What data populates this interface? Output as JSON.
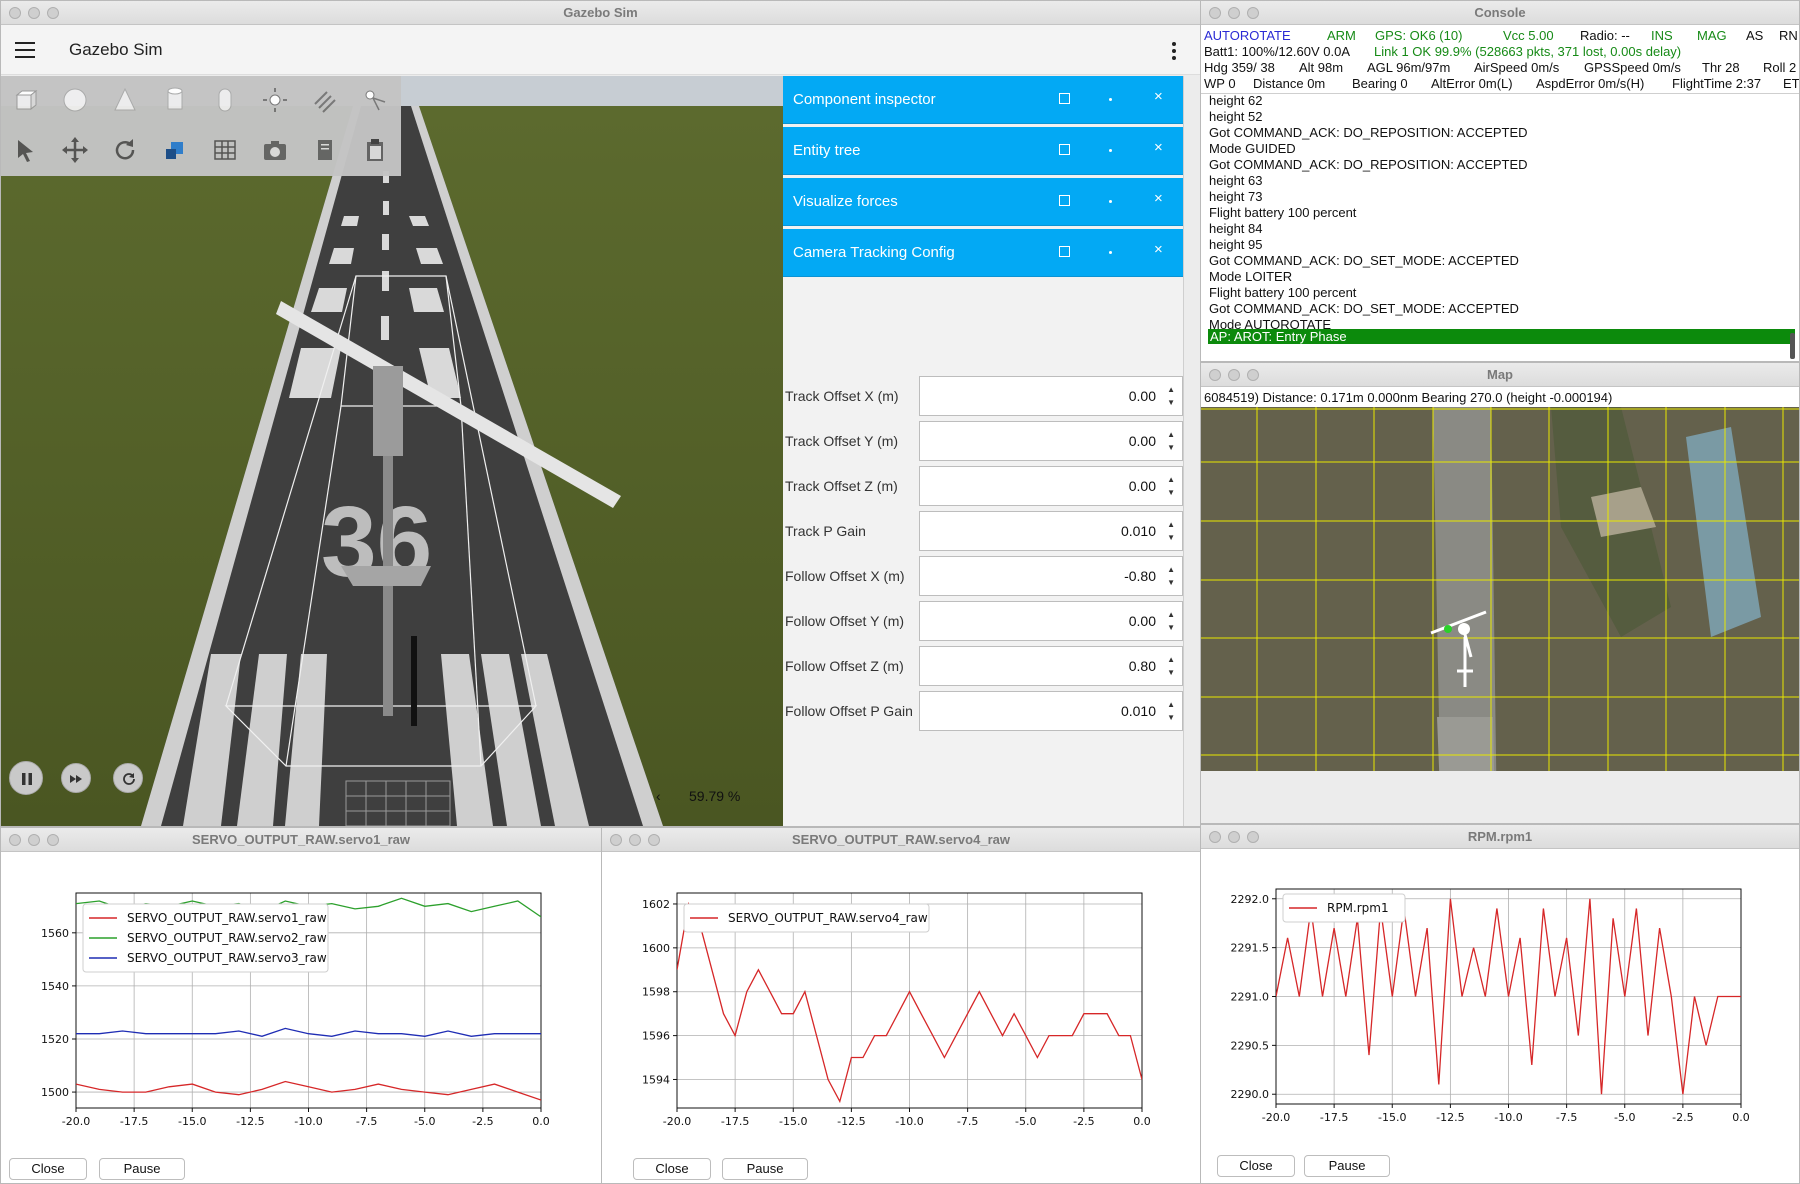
{
  "gazebo": {
    "window_title": "Gazebo Sim",
    "app_title": "Gazebo Sim",
    "rtf": "59.79 %",
    "panels": [
      "Component inspector",
      "Entity tree",
      "Visualize forces",
      "Camera Tracking Config"
    ],
    "runway_number": "36",
    "params": [
      {
        "label": "Track Offset X (m)",
        "value": "0.00"
      },
      {
        "label": "Track Offset Y (m)",
        "value": "0.00"
      },
      {
        "label": "Track Offset Z (m)",
        "value": "0.00"
      },
      {
        "label": "Track P Gain",
        "value": "0.010"
      },
      {
        "label": "Follow Offset X (m)",
        "value": "-0.80"
      },
      {
        "label": "Follow Offset Y (m)",
        "value": "0.00"
      },
      {
        "label": "Follow Offset Z (m)",
        "value": "0.80"
      },
      {
        "label": "Follow Offset P Gain",
        "value": "0.010"
      }
    ]
  },
  "console": {
    "window_title": "Console",
    "status1": {
      "mode": "AUTOROTATE",
      "arm": "ARM",
      "gps": "GPS: OK6 (10)",
      "vcc": "Vcc 5.00",
      "radio": "Radio: --",
      "ins": "INS",
      "mag": "MAG",
      "as": "AS",
      "rn": "RN"
    },
    "status2": {
      "batt": "Batt1: 100%/12.60V 0.0A",
      "link": "Link 1 OK 99.9% (528663 pkts, 371 lost, 0.00s delay)"
    },
    "status3": {
      "hdg": "Hdg 359/ 38",
      "alt": "Alt 98m",
      "agl": "AGL 96m/97m",
      "airspeed": "AirSpeed 0m/s",
      "gpsspeed": "GPSSpeed 0m/s",
      "thr": "Thr 28",
      "roll": "Roll 2"
    },
    "status4": {
      "wp": "WP 0",
      "dist": "Distance 0m",
      "bearing": "Bearing 0",
      "alterr": "AltError 0m(L)",
      "aspderr": "AspdError 0m/s(H)",
      "ftime": "FlightTime 2:37",
      "et": "ET"
    },
    "lines": [
      "height 62",
      "height 52",
      "Got COMMAND_ACK: DO_REPOSITION: ACCEPTED",
      "Mode GUIDED",
      "Got COMMAND_ACK: DO_REPOSITION: ACCEPTED",
      "height 63",
      "height 73",
      "Flight battery 100 percent",
      "height 84",
      "height 95",
      "Got COMMAND_ACK: DO_SET_MODE: ACCEPTED",
      "Mode LOITER",
      "Flight battery 100 percent",
      "Got COMMAND_ACK: DO_SET_MODE: ACCEPTED",
      "Mode AUTOROTATE"
    ],
    "highlight_line": "AP: AROT: Entry Phase"
  },
  "map": {
    "window_title": "Map",
    "info": "6084519)  Distance: 0.171m 0.000nm Bearing 270.0 (height -0.000194)"
  },
  "plot1": {
    "window_title": "SERVO_OUTPUT_RAW.servo1_raw",
    "close": "Close",
    "pause": "Pause",
    "chart_data": {
      "type": "line",
      "xlim": [
        -20,
        0
      ],
      "ylim": [
        1494,
        1575
      ],
      "xticks": [
        "-20.0",
        "-17.5",
        "-15.0",
        "-12.5",
        "-10.0",
        "-7.5",
        "-5.0",
        "-2.5",
        "0.0"
      ],
      "yticks": [
        "1500",
        "1520",
        "1540",
        "1560"
      ],
      "grid": true,
      "legend": "top-left",
      "x": [
        -20,
        -19,
        -18,
        -17,
        -16,
        -15,
        -14,
        -13,
        -12,
        -11,
        -10,
        -9,
        -8,
        -7,
        -6,
        -5,
        -4,
        -3,
        -2,
        -1,
        0
      ],
      "series": [
        {
          "name": "SERVO_OUTPUT_RAW.servo1_raw",
          "color": "#d62728",
          "values": [
            1503,
            1501,
            1500,
            1500,
            1502,
            1503,
            1500,
            1499,
            1501,
            1504,
            1502,
            1500,
            1501,
            1503,
            1501,
            1500,
            1499,
            1501,
            1503,
            1500,
            1497
          ]
        },
        {
          "name": "SERVO_OUTPUT_RAW.servo2_raw",
          "color": "#2ca02c",
          "values": [
            1571,
            1572,
            1569,
            1571,
            1570,
            1572,
            1570,
            1571,
            1568,
            1572,
            1570,
            1571,
            1569,
            1570,
            1573,
            1570,
            1571,
            1568,
            1570,
            1572,
            1566
          ]
        },
        {
          "name": "SERVO_OUTPUT_RAW.servo3_raw",
          "color": "#1f2db4",
          "values": [
            1522,
            1522,
            1523,
            1522,
            1522,
            1522,
            1522,
            1523,
            1521,
            1524,
            1522,
            1521,
            1523,
            1522,
            1522,
            1521,
            1523,
            1521,
            1522,
            1522,
            1522
          ]
        }
      ]
    }
  },
  "plot2": {
    "window_title": "SERVO_OUTPUT_RAW.servo4_raw",
    "close": "Close",
    "pause": "Pause",
    "chart_data": {
      "type": "line",
      "xlim": [
        -20,
        0
      ],
      "ylim": [
        1592.7,
        1602.5
      ],
      "xticks": [
        "-20.0",
        "-17.5",
        "-15.0",
        "-12.5",
        "-10.0",
        "-7.5",
        "-5.0",
        "-2.5",
        "0.0"
      ],
      "yticks": [
        "1594",
        "1596",
        "1598",
        "1600",
        "1602"
      ],
      "grid": true,
      "legend": "top-left",
      "x": [
        -20,
        -19.5,
        -19,
        -18.5,
        -18,
        -17.5,
        -17,
        -16.5,
        -16,
        -15.5,
        -15,
        -14.5,
        -14,
        -13.5,
        -13,
        -12.5,
        -12,
        -11.5,
        -11,
        -10.5,
        -10,
        -9.5,
        -9,
        -8.5,
        -8,
        -7.5,
        -7,
        -6.5,
        -6,
        -5.5,
        -5,
        -4.5,
        -4,
        -3.5,
        -3,
        -2.5,
        -2,
        -1.5,
        -1,
        -0.5,
        0
      ],
      "series": [
        {
          "name": "SERVO_OUTPUT_RAW.servo4_raw",
          "color": "#d62728",
          "values": [
            1599,
            1602,
            1601,
            1599,
            1597,
            1596,
            1598,
            1599,
            1598,
            1597,
            1597,
            1598,
            1596,
            1594,
            1593,
            1595,
            1595,
            1596,
            1596,
            1597,
            1598,
            1597,
            1596,
            1595,
            1596,
            1597,
            1598,
            1597,
            1596,
            1597,
            1596,
            1595,
            1596,
            1596,
            1596,
            1597,
            1597,
            1597,
            1596,
            1596,
            1594
          ]
        }
      ]
    }
  },
  "plot3": {
    "window_title": "RPM.rpm1",
    "close": "Close",
    "pause": "Pause",
    "chart_data": {
      "type": "line",
      "xlim": [
        -20,
        0
      ],
      "ylim": [
        2289.9,
        2292.1
      ],
      "xticks": [
        "-20.0",
        "-17.5",
        "-15.0",
        "-12.5",
        "-10.0",
        "-7.5",
        "-5.0",
        "-2.5",
        "0.0"
      ],
      "yticks": [
        "2290.0",
        "2290.5",
        "2291.0",
        "2291.5",
        "2292.0"
      ],
      "grid": true,
      "legend": "top-left",
      "x": [
        -20,
        -19.5,
        -19,
        -18.5,
        -18,
        -17.5,
        -17,
        -16.5,
        -16,
        -15.5,
        -15,
        -14.5,
        -14,
        -13.5,
        -13,
        -12.5,
        -12,
        -11.5,
        -11,
        -10.5,
        -10,
        -9.5,
        -9,
        -8.5,
        -8,
        -7.5,
        -7,
        -6.5,
        -6,
        -5.5,
        -5,
        -4.5,
        -4,
        -3.5,
        -3,
        -2.5,
        -2,
        -1.5,
        -1,
        -0.5,
        0
      ],
      "series": [
        {
          "name": "RPM.rpm1",
          "color": "#d62728",
          "values": [
            2291.0,
            2291.6,
            2291.0,
            2291.9,
            2291.0,
            2291.7,
            2291.0,
            2291.8,
            2290.4,
            2291.9,
            2291.0,
            2291.9,
            2291.0,
            2291.7,
            2290.1,
            2292.0,
            2291.0,
            2291.5,
            2291.0,
            2291.9,
            2291.0,
            2291.6,
            2290.3,
            2291.9,
            2291.0,
            2291.6,
            2290.6,
            2292.0,
            2290.0,
            2291.8,
            2291.0,
            2291.9,
            2290.6,
            2291.7,
            2291.0,
            2290.0,
            2291.0,
            2290.5,
            2291.0,
            2291.0,
            2291.0
          ]
        }
      ]
    }
  }
}
